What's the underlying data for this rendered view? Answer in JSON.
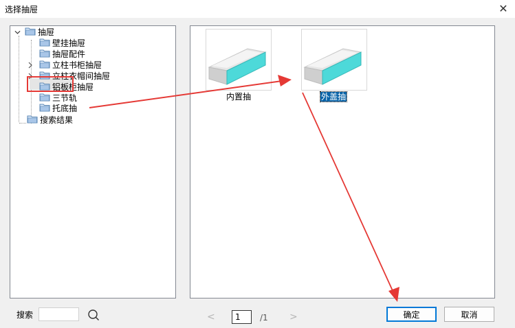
{
  "window": {
    "title": "选择抽屉"
  },
  "tree": {
    "root_label": "抽屉",
    "items": [
      {
        "label": "壁挂抽屉"
      },
      {
        "label": "抽屉配件"
      },
      {
        "label": "立柱书柜抽屉"
      },
      {
        "label": "立柱衣帽间抽屉"
      },
      {
        "label": "铝板柜抽屉"
      },
      {
        "label": "三节轨"
      },
      {
        "label": "托底抽"
      }
    ],
    "search_results_label": "搜索结果"
  },
  "files": [
    {
      "label": "内置抽"
    },
    {
      "label": "外盖抽"
    }
  ],
  "search": {
    "label": "搜索",
    "value": ""
  },
  "pager": {
    "prev": "<",
    "next": ">",
    "current": "1",
    "total": "/1"
  },
  "buttons": {
    "ok": "确定",
    "cancel": "取消"
  },
  "colors": {
    "annotation_red": "#e53935",
    "selection_blue": "#0a64a8",
    "drawer_cyan": "#4dd9d9"
  }
}
